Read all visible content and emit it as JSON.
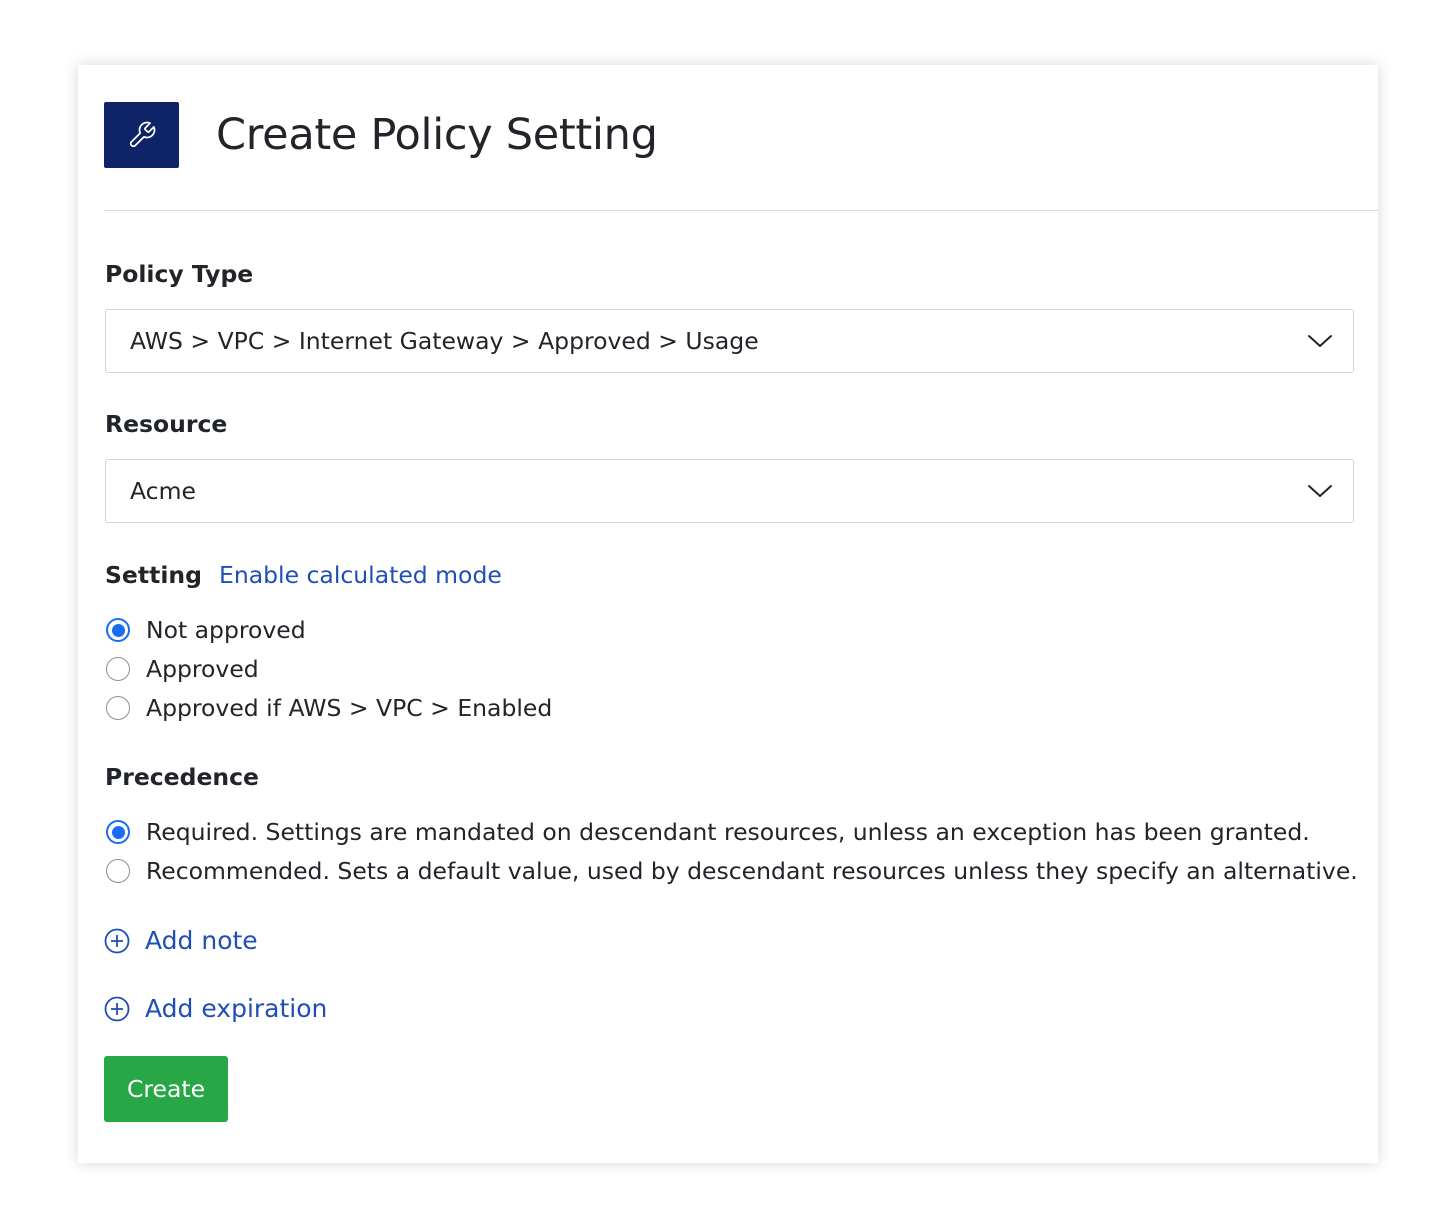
{
  "colors": {
    "header_icon_bg": "#0f2468",
    "link": "#1f4fb5",
    "radio_checked": "#1a6cf2",
    "create_button": "#27a745"
  },
  "header": {
    "icon": "wrench-icon",
    "title": "Create Policy Setting"
  },
  "policy_type": {
    "label": "Policy Type",
    "selected": "AWS > VPC > Internet Gateway > Approved > Usage"
  },
  "resource": {
    "label": "Resource",
    "selected": "Acme"
  },
  "setting": {
    "label": "Setting",
    "calculated_mode_link": "Enable calculated mode",
    "options": [
      {
        "label": "Not approved",
        "checked": true
      },
      {
        "label": "Approved",
        "checked": false
      },
      {
        "label": "Approved if AWS > VPC > Enabled",
        "checked": false
      }
    ]
  },
  "precedence": {
    "label": "Precedence",
    "options": [
      {
        "label": "Required. Settings are mandated on descendant resources, unless an exception has been granted.",
        "checked": true
      },
      {
        "label": "Recommended. Sets a default value, used by descendant resources unless they specify an alternative.",
        "checked": false
      }
    ]
  },
  "actions": {
    "add_note": "Add note",
    "add_expiration": "Add expiration",
    "create": "Create"
  }
}
